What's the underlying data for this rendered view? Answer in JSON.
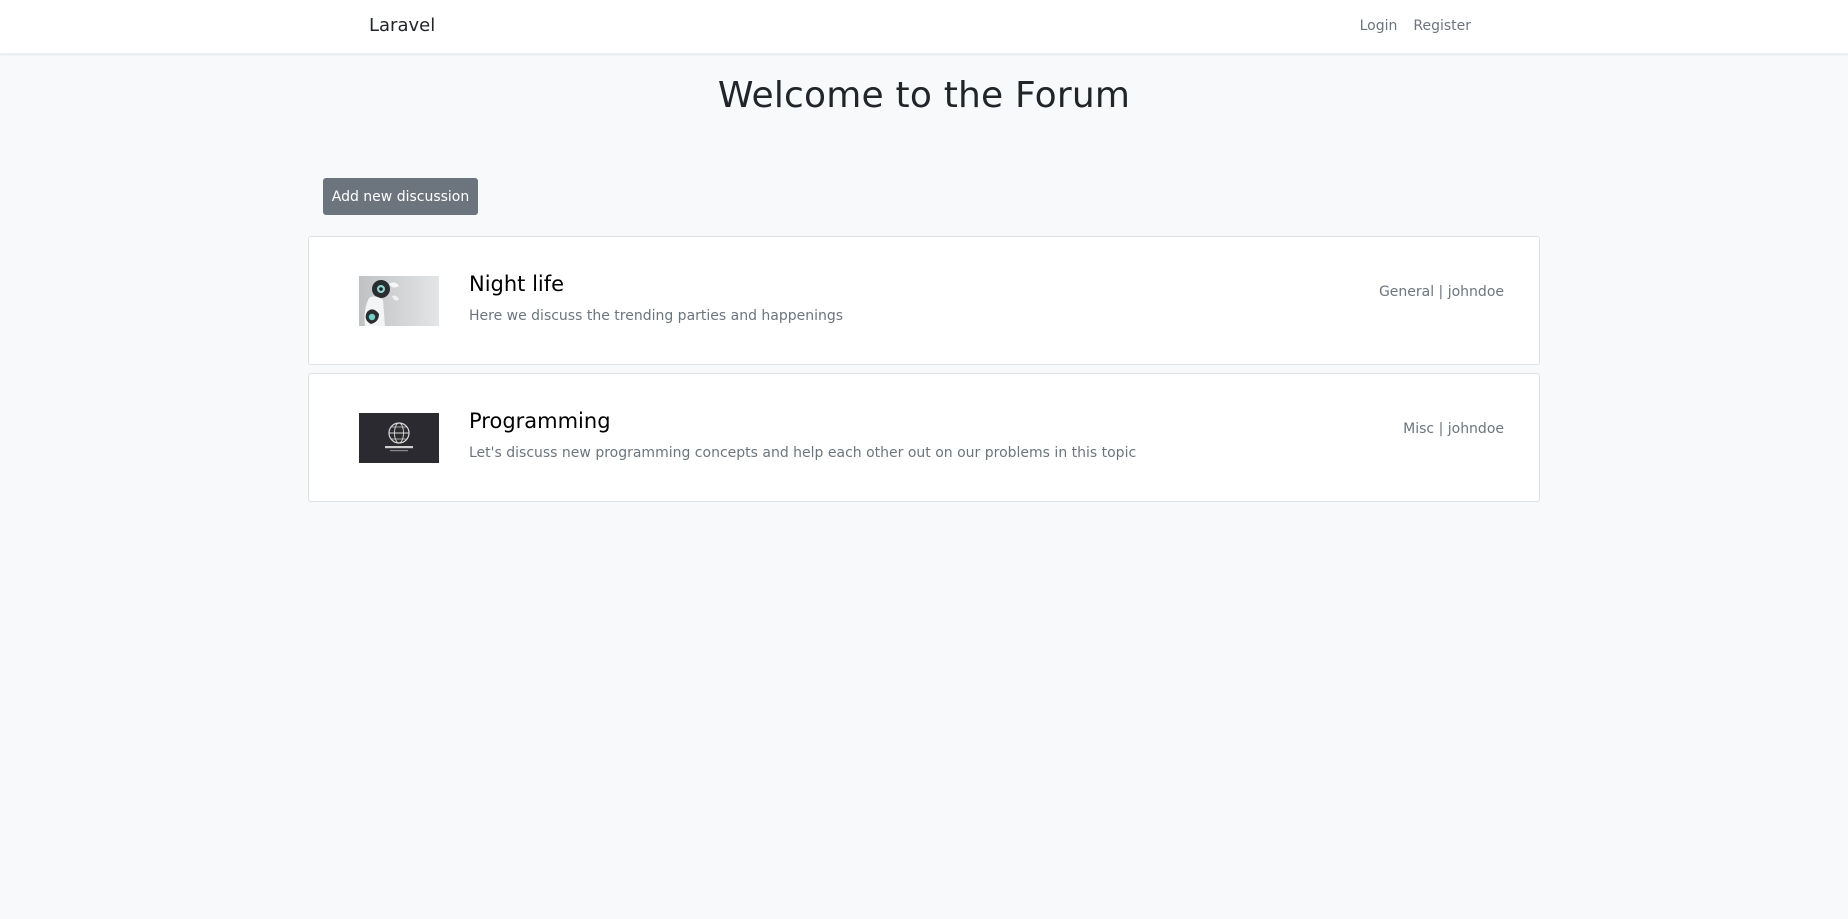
{
  "navbar": {
    "brand": "Laravel",
    "links": [
      {
        "label": "Login"
      },
      {
        "label": "Register"
      }
    ]
  },
  "page": {
    "title": "Welcome to the Forum",
    "add_button_label": "Add new discussion"
  },
  "discussions": [
    {
      "title": "Night life",
      "description": "Here we discuss the trending parties and happenings",
      "category": "General",
      "author": "johndoe",
      "meta": "General | johndoe",
      "thumbnail": "robot-image"
    },
    {
      "title": "Programming",
      "description": "Let's discuss new programming concepts and help each other out on our problems in this topic",
      "category": "Misc",
      "author": "johndoe",
      "meta": "Misc | johndoe",
      "thumbnail": "globe-logo-image"
    }
  ],
  "colors": {
    "background": "#f8f9fa",
    "button": "#6c757d",
    "muted_text": "#6c757d",
    "card_border": "#dee2e6"
  }
}
